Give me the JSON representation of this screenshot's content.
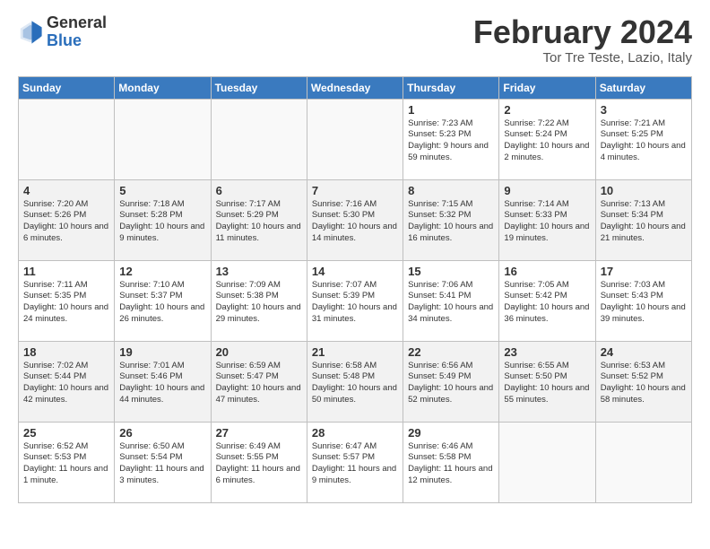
{
  "header": {
    "logo_general": "General",
    "logo_blue": "Blue",
    "month_title": "February 2024",
    "subtitle": "Tor Tre Teste, Lazio, Italy"
  },
  "days_of_week": [
    "Sunday",
    "Monday",
    "Tuesday",
    "Wednesday",
    "Thursday",
    "Friday",
    "Saturday"
  ],
  "weeks": [
    [
      {
        "day": "",
        "sunrise": "",
        "sunset": "",
        "daylight": ""
      },
      {
        "day": "",
        "sunrise": "",
        "sunset": "",
        "daylight": ""
      },
      {
        "day": "",
        "sunrise": "",
        "sunset": "",
        "daylight": ""
      },
      {
        "day": "",
        "sunrise": "",
        "sunset": "",
        "daylight": ""
      },
      {
        "day": "1",
        "sunrise": "Sunrise: 7:23 AM",
        "sunset": "Sunset: 5:23 PM",
        "daylight": "Daylight: 9 hours and 59 minutes."
      },
      {
        "day": "2",
        "sunrise": "Sunrise: 7:22 AM",
        "sunset": "Sunset: 5:24 PM",
        "daylight": "Daylight: 10 hours and 2 minutes."
      },
      {
        "day": "3",
        "sunrise": "Sunrise: 7:21 AM",
        "sunset": "Sunset: 5:25 PM",
        "daylight": "Daylight: 10 hours and 4 minutes."
      }
    ],
    [
      {
        "day": "4",
        "sunrise": "Sunrise: 7:20 AM",
        "sunset": "Sunset: 5:26 PM",
        "daylight": "Daylight: 10 hours and 6 minutes."
      },
      {
        "day": "5",
        "sunrise": "Sunrise: 7:18 AM",
        "sunset": "Sunset: 5:28 PM",
        "daylight": "Daylight: 10 hours and 9 minutes."
      },
      {
        "day": "6",
        "sunrise": "Sunrise: 7:17 AM",
        "sunset": "Sunset: 5:29 PM",
        "daylight": "Daylight: 10 hours and 11 minutes."
      },
      {
        "day": "7",
        "sunrise": "Sunrise: 7:16 AM",
        "sunset": "Sunset: 5:30 PM",
        "daylight": "Daylight: 10 hours and 14 minutes."
      },
      {
        "day": "8",
        "sunrise": "Sunrise: 7:15 AM",
        "sunset": "Sunset: 5:32 PM",
        "daylight": "Daylight: 10 hours and 16 minutes."
      },
      {
        "day": "9",
        "sunrise": "Sunrise: 7:14 AM",
        "sunset": "Sunset: 5:33 PM",
        "daylight": "Daylight: 10 hours and 19 minutes."
      },
      {
        "day": "10",
        "sunrise": "Sunrise: 7:13 AM",
        "sunset": "Sunset: 5:34 PM",
        "daylight": "Daylight: 10 hours and 21 minutes."
      }
    ],
    [
      {
        "day": "11",
        "sunrise": "Sunrise: 7:11 AM",
        "sunset": "Sunset: 5:35 PM",
        "daylight": "Daylight: 10 hours and 24 minutes."
      },
      {
        "day": "12",
        "sunrise": "Sunrise: 7:10 AM",
        "sunset": "Sunset: 5:37 PM",
        "daylight": "Daylight: 10 hours and 26 minutes."
      },
      {
        "day": "13",
        "sunrise": "Sunrise: 7:09 AM",
        "sunset": "Sunset: 5:38 PM",
        "daylight": "Daylight: 10 hours and 29 minutes."
      },
      {
        "day": "14",
        "sunrise": "Sunrise: 7:07 AM",
        "sunset": "Sunset: 5:39 PM",
        "daylight": "Daylight: 10 hours and 31 minutes."
      },
      {
        "day": "15",
        "sunrise": "Sunrise: 7:06 AM",
        "sunset": "Sunset: 5:41 PM",
        "daylight": "Daylight: 10 hours and 34 minutes."
      },
      {
        "day": "16",
        "sunrise": "Sunrise: 7:05 AM",
        "sunset": "Sunset: 5:42 PM",
        "daylight": "Daylight: 10 hours and 36 minutes."
      },
      {
        "day": "17",
        "sunrise": "Sunrise: 7:03 AM",
        "sunset": "Sunset: 5:43 PM",
        "daylight": "Daylight: 10 hours and 39 minutes."
      }
    ],
    [
      {
        "day": "18",
        "sunrise": "Sunrise: 7:02 AM",
        "sunset": "Sunset: 5:44 PM",
        "daylight": "Daylight: 10 hours and 42 minutes."
      },
      {
        "day": "19",
        "sunrise": "Sunrise: 7:01 AM",
        "sunset": "Sunset: 5:46 PM",
        "daylight": "Daylight: 10 hours and 44 minutes."
      },
      {
        "day": "20",
        "sunrise": "Sunrise: 6:59 AM",
        "sunset": "Sunset: 5:47 PM",
        "daylight": "Daylight: 10 hours and 47 minutes."
      },
      {
        "day": "21",
        "sunrise": "Sunrise: 6:58 AM",
        "sunset": "Sunset: 5:48 PM",
        "daylight": "Daylight: 10 hours and 50 minutes."
      },
      {
        "day": "22",
        "sunrise": "Sunrise: 6:56 AM",
        "sunset": "Sunset: 5:49 PM",
        "daylight": "Daylight: 10 hours and 52 minutes."
      },
      {
        "day": "23",
        "sunrise": "Sunrise: 6:55 AM",
        "sunset": "Sunset: 5:50 PM",
        "daylight": "Daylight: 10 hours and 55 minutes."
      },
      {
        "day": "24",
        "sunrise": "Sunrise: 6:53 AM",
        "sunset": "Sunset: 5:52 PM",
        "daylight": "Daylight: 10 hours and 58 minutes."
      }
    ],
    [
      {
        "day": "25",
        "sunrise": "Sunrise: 6:52 AM",
        "sunset": "Sunset: 5:53 PM",
        "daylight": "Daylight: 11 hours and 1 minute."
      },
      {
        "day": "26",
        "sunrise": "Sunrise: 6:50 AM",
        "sunset": "Sunset: 5:54 PM",
        "daylight": "Daylight: 11 hours and 3 minutes."
      },
      {
        "day": "27",
        "sunrise": "Sunrise: 6:49 AM",
        "sunset": "Sunset: 5:55 PM",
        "daylight": "Daylight: 11 hours and 6 minutes."
      },
      {
        "day": "28",
        "sunrise": "Sunrise: 6:47 AM",
        "sunset": "Sunset: 5:57 PM",
        "daylight": "Daylight: 11 hours and 9 minutes."
      },
      {
        "day": "29",
        "sunrise": "Sunrise: 6:46 AM",
        "sunset": "Sunset: 5:58 PM",
        "daylight": "Daylight: 11 hours and 12 minutes."
      },
      {
        "day": "",
        "sunrise": "",
        "sunset": "",
        "daylight": ""
      },
      {
        "day": "",
        "sunrise": "",
        "sunset": "",
        "daylight": ""
      }
    ]
  ]
}
